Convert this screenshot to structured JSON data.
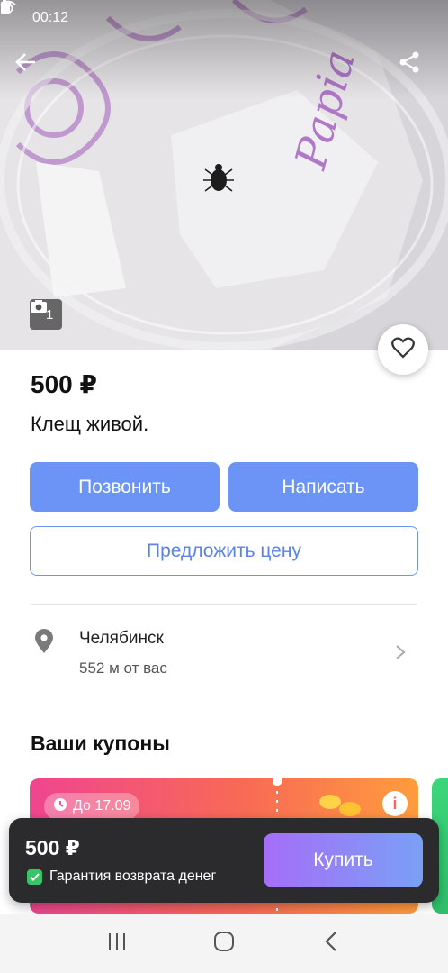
{
  "status_bar": {
    "time": "00:12"
  },
  "photo": {
    "count": "1",
    "watermark_text": "Papia"
  },
  "listing": {
    "price": "500 ₽",
    "title": "Клещ живой."
  },
  "actions": {
    "call_label": "Позвонить",
    "message_label": "Написать",
    "offer_price_label": "Предложить цену"
  },
  "location": {
    "city": "Челябинск",
    "distance": "552 м от вас"
  },
  "coupons": {
    "section_title": "Ваши купоны",
    "badge_text": "До 17.09",
    "info_glyph": "i"
  },
  "buy_bar": {
    "price": "500 ₽",
    "guarantee": "Гарантия возврата денег",
    "buy_label": "Купить"
  },
  "colors": {
    "accent_blue": "#6b94f6",
    "coupon_pink": "#f0458f",
    "coupon_orange": "#ff9c3d",
    "buy_gradient_start": "#a56ef8",
    "buy_gradient_end": "#7aa0f5",
    "guarantee_green": "#39c46a"
  },
  "icons": {
    "back": "back-arrow-icon",
    "share": "share-icon",
    "camera": "camera-icon",
    "favorite": "heart-icon",
    "location": "location-pin-icon",
    "chevron": "chevron-right-icon",
    "clock": "clock-icon",
    "check": "check-icon"
  }
}
